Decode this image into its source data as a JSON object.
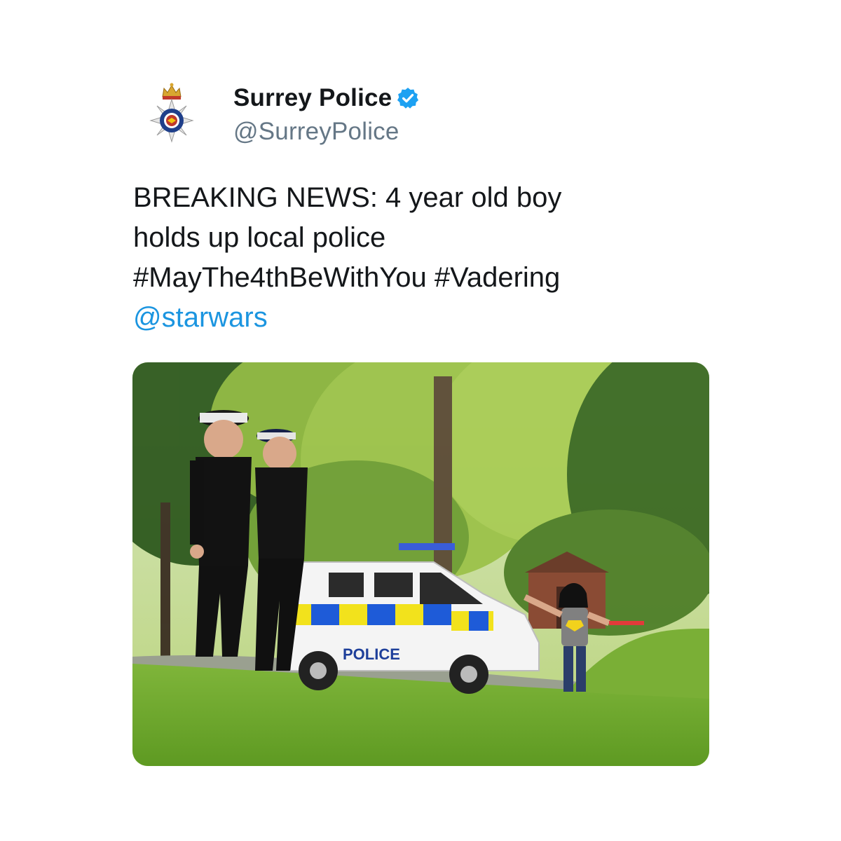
{
  "tweet": {
    "author": {
      "display_name": "Surrey Police",
      "handle": "@SurreyPolice",
      "verified": true,
      "avatar_icon": "police-crest-icon"
    },
    "text_lines": [
      "BREAKING NEWS: 4 year old boy",
      "holds up local police",
      "#MayThe4thBeWithYou #Vadering"
    ],
    "mention": "@starwars",
    "media": {
      "van_livery_text": "POLICE"
    }
  },
  "colors": {
    "text": "#14171a",
    "secondary_text": "#657786",
    "link": "#1b95e0",
    "verified_badge": "#1da1f2"
  }
}
